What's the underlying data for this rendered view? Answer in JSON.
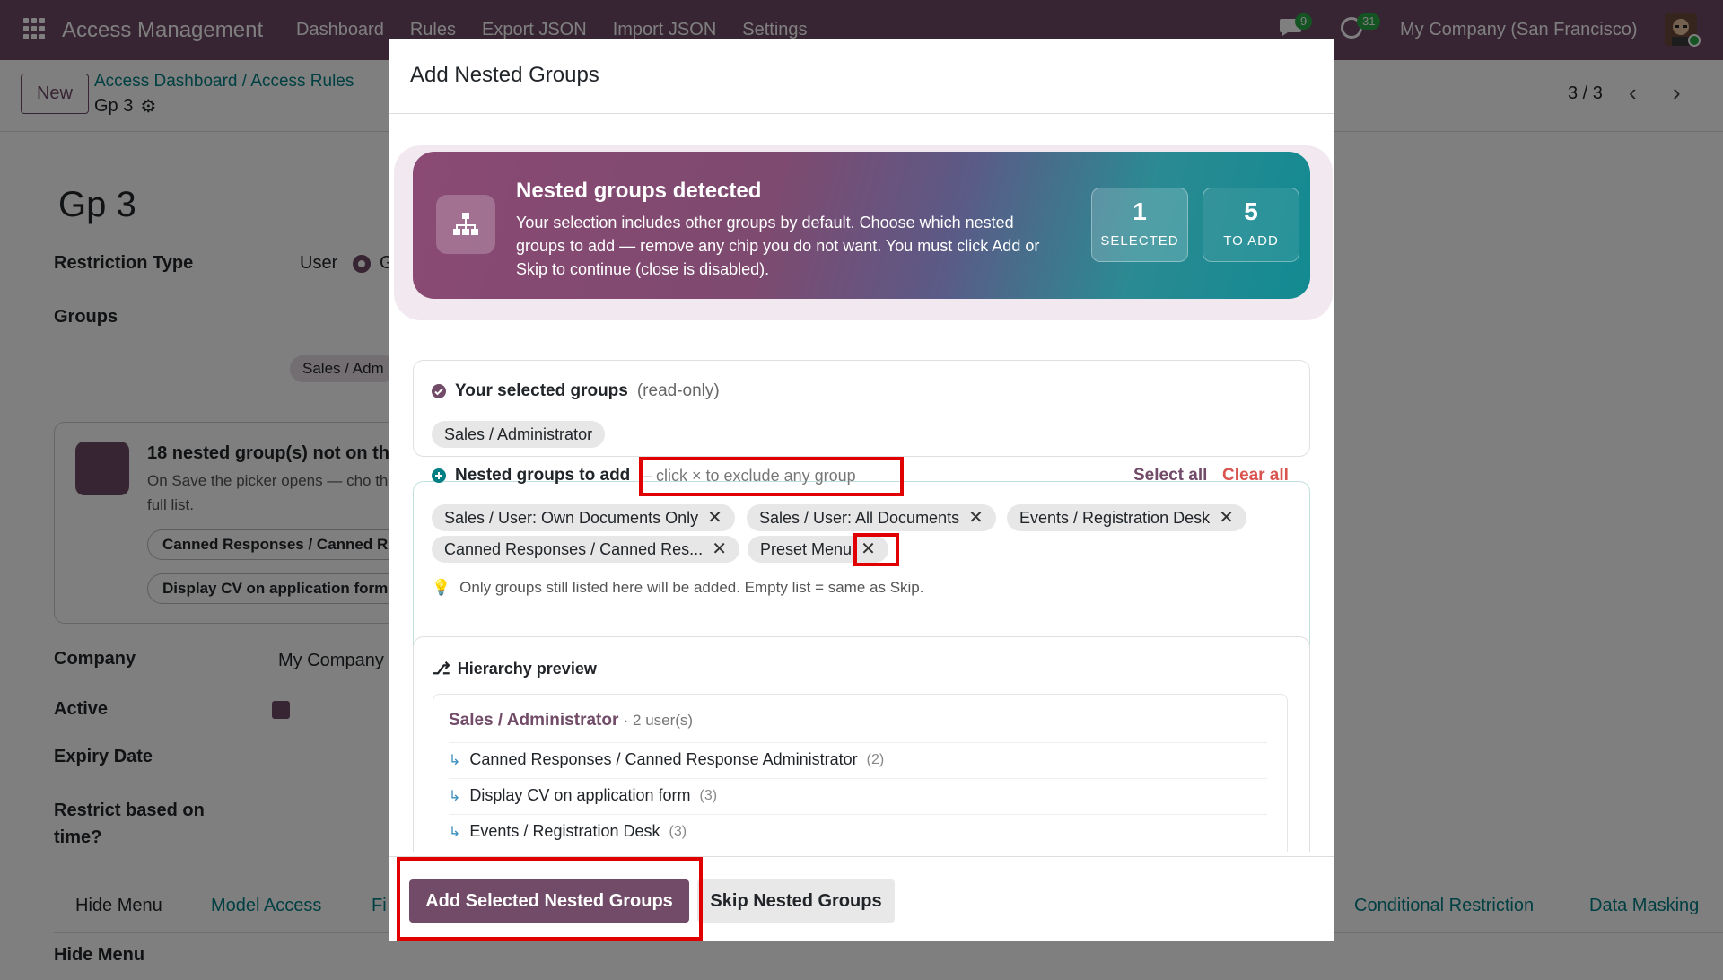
{
  "topbar": {
    "app_title": "Access Management",
    "menu": [
      "Dashboard",
      "Rules",
      "Export JSON",
      "Import JSON",
      "Settings"
    ],
    "chat_count": "9",
    "activity_count": "31",
    "company": "My Company (San Francisco)"
  },
  "control": {
    "new_label": "New",
    "breadcrumb": [
      "Access Dashboard",
      "Access Rules"
    ],
    "record": "Gp 3",
    "pager": "3 / 3"
  },
  "form": {
    "title": "Gp 3",
    "restriction_type_label": "Restriction Type",
    "restriction_type_value": "User",
    "restriction_type_value2": "G",
    "groups_label": "Groups",
    "group_tag": "Sales / Adm",
    "warn_title": "18 nested group(s) not on th",
    "warn_text": "On Save the picker opens — cho the full list.",
    "warn_chips": [
      "Canned Responses / Canned R",
      "Display CV on application form"
    ],
    "company_label": "Company",
    "company_value": "My Company",
    "active_label": "Active",
    "expiry_label": "Expiry Date",
    "restrict_time_label": "Restrict based on time?",
    "hide_menu_label": "Hide Menu",
    "tabs": [
      "Hide Menu",
      "Model Access",
      "Fi",
      "Conditional Restriction",
      "Data Masking"
    ]
  },
  "modal": {
    "title": "Add Nested Groups",
    "hero": {
      "title": "Nested groups detected",
      "text": "Your selection includes other groups by default. Choose which nested groups to add — remove any chip you do not want. You must click Add or Skip to continue (close is disabled).",
      "selected_count": "1",
      "selected_label": "SELECTED",
      "add_count": "5",
      "add_label": "TO ADD"
    },
    "selected": {
      "title": "Your selected groups",
      "muted": "(read-only)",
      "chips": [
        "Sales / Administrator"
      ]
    },
    "nested": {
      "title": "Nested groups to add",
      "instruction": "– click × to exclude any group",
      "select_all": "Select all",
      "clear_all": "Clear all",
      "chips": [
        "Sales / User: Own Documents Only",
        "Sales / User: All Documents",
        "Events / Registration Desk",
        "Canned Responses / Canned Res...",
        "Preset Menu"
      ],
      "hint": "Only groups still listed here will be added. Empty list = same as Skip."
    },
    "hierarchy": {
      "title": "Hierarchy preview",
      "root": "Sales / Administrator",
      "root_count": "· 2 user(s)",
      "items": [
        {
          "label": "Canned Responses / Canned Response Administrator",
          "count": "(2)"
        },
        {
          "label": "Display CV on application form",
          "count": "(3)"
        },
        {
          "label": "Events / Registration Desk",
          "count": "(3)"
        }
      ]
    },
    "buttons": {
      "add": "Add Selected Nested Groups",
      "skip": "Skip Nested Groups"
    }
  },
  "colors": {
    "brand": "#714b67",
    "teal": "#017e84",
    "danger": "#d9534f",
    "highlight": "#e00000"
  }
}
